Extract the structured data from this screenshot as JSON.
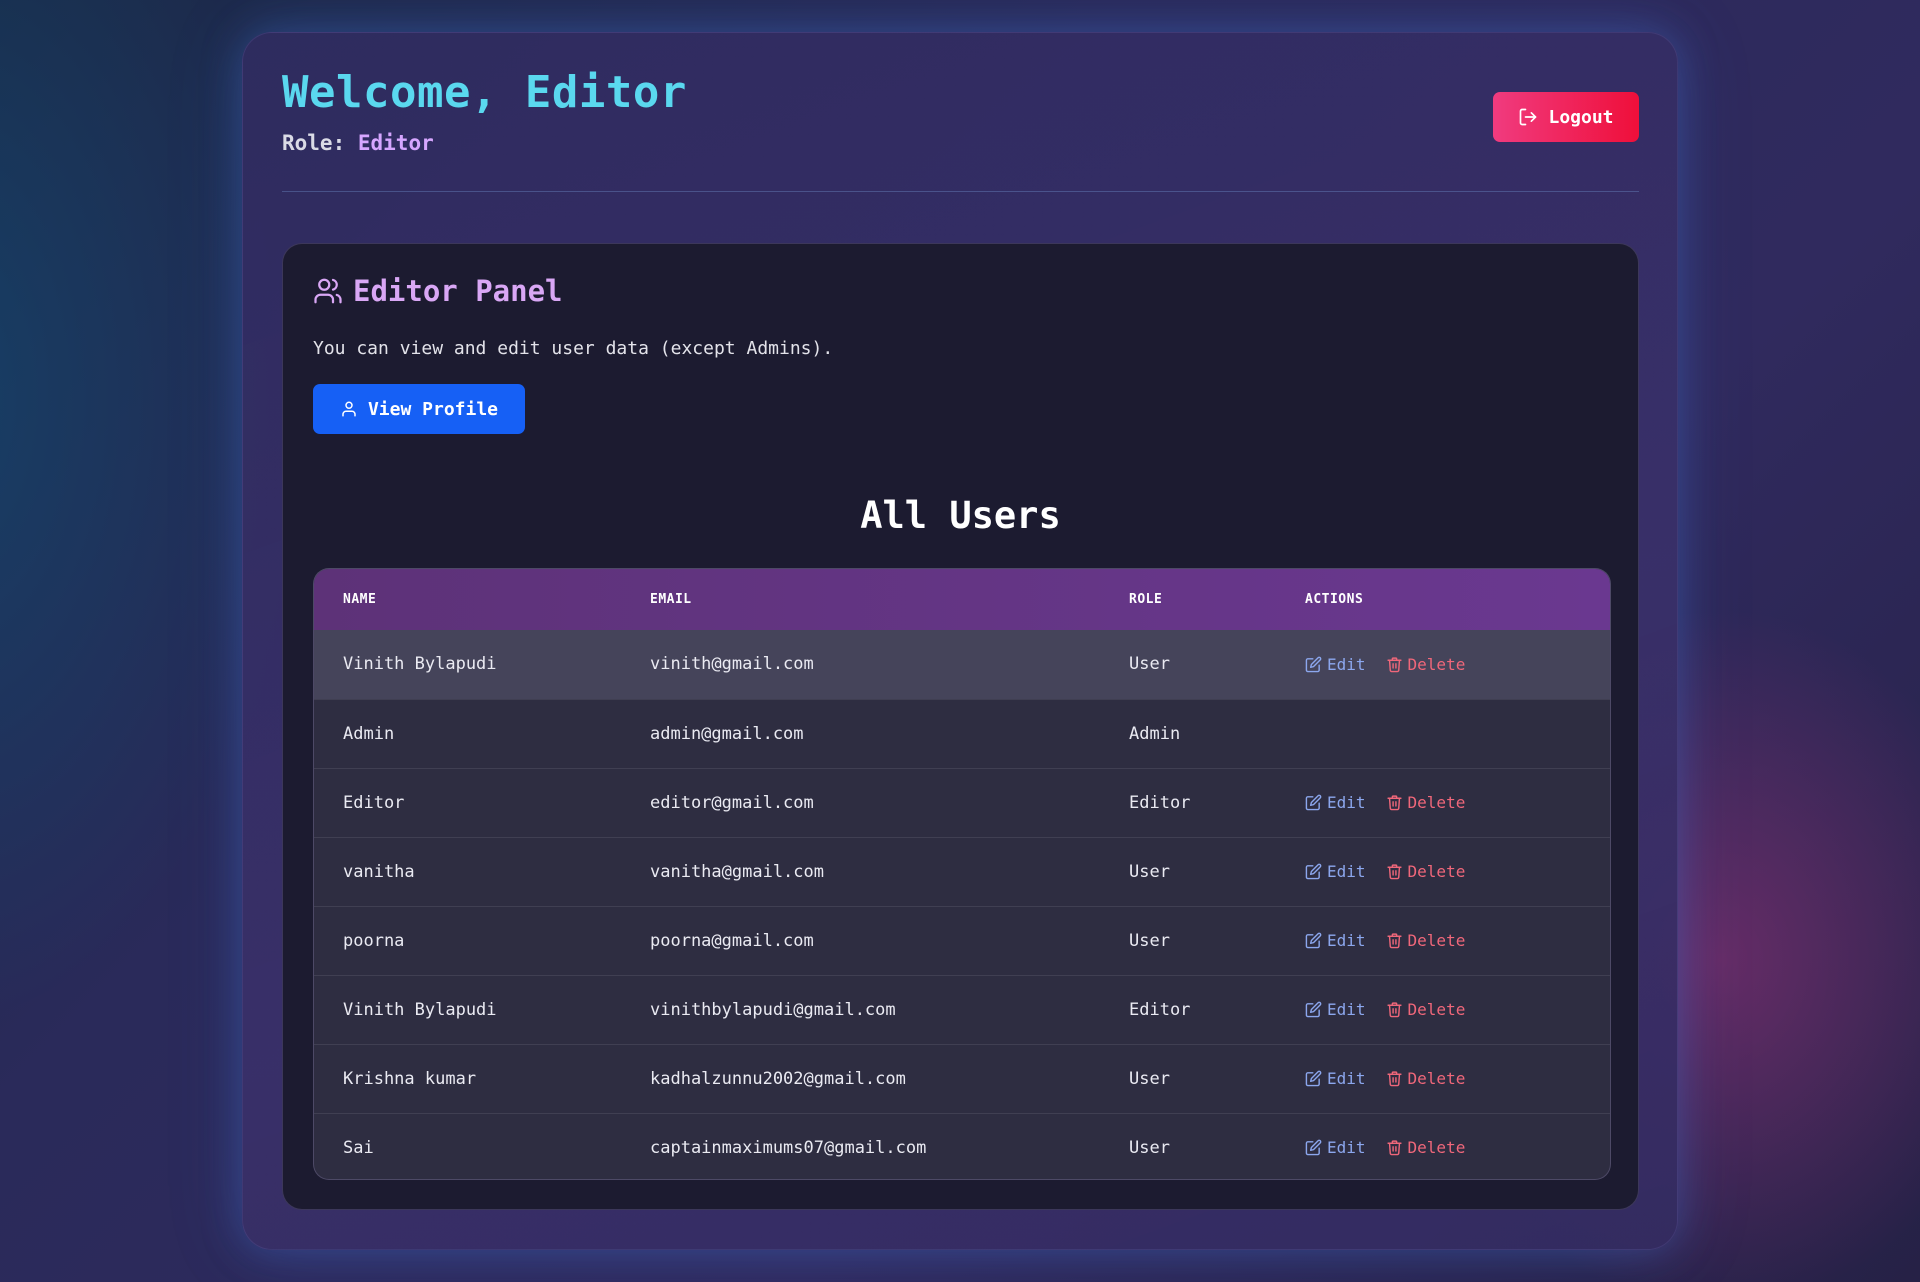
{
  "header": {
    "welcome_title": "Welcome, Editor",
    "role_label": "Role:",
    "role_value": "Editor",
    "logout_label": "Logout"
  },
  "panel": {
    "title": "Editor Panel",
    "description": "You can view and edit user data (except Admins).",
    "view_profile_label": "View Profile"
  },
  "users_section": {
    "title": "All Users",
    "columns": [
      "NAME",
      "EMAIL",
      "ROLE",
      "ACTIONS"
    ],
    "edit_label": "Edit",
    "delete_label": "Delete",
    "rows": [
      {
        "name": "Vinith Bylapudi",
        "email": "vinith@gmail.com",
        "role": "User",
        "editable": true
      },
      {
        "name": "Admin",
        "email": "admin@gmail.com",
        "role": "Admin",
        "editable": false
      },
      {
        "name": "Editor",
        "email": "editor@gmail.com",
        "role": "Editor",
        "editable": true
      },
      {
        "name": "vanitha",
        "email": "vanitha@gmail.com",
        "role": "User",
        "editable": true
      },
      {
        "name": "poorna",
        "email": "poorna@gmail.com",
        "role": "User",
        "editable": true
      },
      {
        "name": "Vinith Bylapudi",
        "email": "vinithbylapudi@gmail.com",
        "role": "Editor",
        "editable": true
      },
      {
        "name": "Krishna kumar",
        "email": "kadhalzunnu2002@gmail.com",
        "role": "User",
        "editable": true
      },
      {
        "name": "Sai",
        "email": "captainmaximums07@gmail.com",
        "role": "User",
        "editable": true
      }
    ]
  },
  "icons": {
    "logout": "logout-icon",
    "panel": "users-icon",
    "view_profile": "user-icon",
    "edit": "edit-icon",
    "delete": "trash-icon"
  },
  "colors": {
    "welcome": "#5ad8ef",
    "role_value": "#d6a6ff",
    "panel_title": "#d9a7f5",
    "logout_start": "#f03b7f",
    "logout_end": "#ef0f3a",
    "view_profile": "#1660f5",
    "table_header": "#5d3278",
    "edit": "#8ca7ee",
    "delete": "#f0677a"
  }
}
